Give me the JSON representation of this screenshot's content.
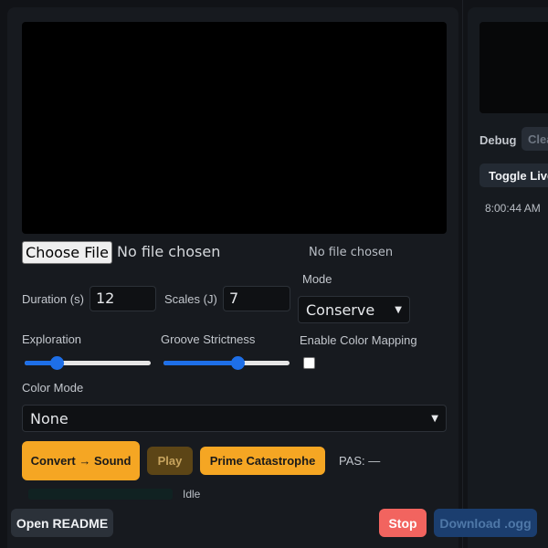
{
  "file": {
    "button_label": "Choose File",
    "status": "No file chosen",
    "status_secondary": "No file chosen"
  },
  "params": {
    "duration_label": "Duration (s)",
    "duration_value": "12",
    "scales_label": "Scales (J)",
    "scales_value": "7",
    "mode_label": "Mode",
    "mode_value": "Conserve",
    "exploration_label": "Exploration",
    "exploration_level": 0.25,
    "groove_label": "Groove Strictness",
    "groove_level": 0.59,
    "color_mapping_label": "Enable Color Mapping",
    "color_mapping_checked": false,
    "color_mode_label": "Color Mode",
    "color_mode_value": "None"
  },
  "actions": {
    "convert_label": "Convert → Sound",
    "play_label": "Play",
    "prime_label": "Prime Catastrophe",
    "pas_text": "PAS: —",
    "status_text": "Idle",
    "progress": 0
  },
  "footer": {
    "readme_label": "Open README",
    "stop_label": "Stop",
    "download_label": "Download .ogg"
  },
  "debug": {
    "label": "Debug",
    "clear_label": "Clear",
    "toggle_label": "Toggle Live",
    "log_time": "8:00:44 AM"
  },
  "colors": {
    "accent": "#f5a623",
    "slider": "#1e6fe8",
    "stop": "#f2645f",
    "download": "#1b3e6f"
  }
}
